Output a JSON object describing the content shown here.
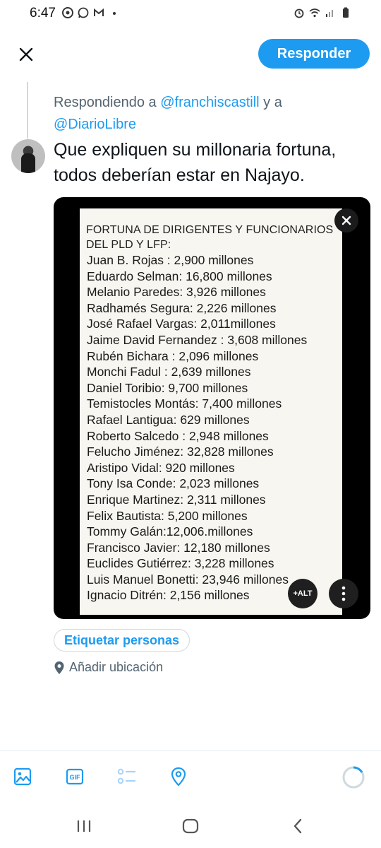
{
  "status_bar": {
    "time": "6:47",
    "left_icons": [
      "chrome-icon",
      "whatsapp-icon",
      "gmail-icon",
      "dot-icon"
    ],
    "right_icons": [
      "alarm-icon",
      "wifi-icon",
      "signal-icon",
      "battery-icon"
    ]
  },
  "header": {
    "reply_button_label": "Responder"
  },
  "reply_context": {
    "prefix": "Respondiendo a ",
    "handle_1": "@franchiscastill",
    "connector": " y a ",
    "handle_2": "@DiarioLibre"
  },
  "tweet": {
    "text": "Que expliquen su millonaria fortuna, todos deberían estar en Najayo."
  },
  "media": {
    "title": "FORTUNA DE DIRIGENTES Y FUNCIONARIOS\nDEL PLD Y LFP:",
    "lines": [
      "Juan B. Rojas : 2,900 millones",
      "Eduardo Selman: 16,800 millones",
      "Melanio Paredes: 3,926 millones",
      "Radhamés Segura: 2,226 millones",
      "José Rafael Vargas: 2,011millones",
      "Jaime David Fernandez : 3,608 millones",
      "Rubén Bichara : 2,096 millones",
      "Monchi Fadul : 2,639 millones",
      "Daniel Toribio: 9,700 millones",
      "Temistocles Montás: 7,400 millones",
      "Rafael Lantigua: 629 millones",
      "Roberto Salcedo : 2,948 millones",
      "Felucho Jiménez: 32,828 millones",
      "Aristipo Vidal: 920 millones",
      "Tony Isa Conde: 2,023 millones",
      "Enrique Martinez: 2,311 millones",
      "Felix Bautista: 5,200 millones",
      "Tommy Galán:12,006.millones",
      "Francisco Javier: 12,180 millones",
      "Euclides Gutiérrez: 3,228 millones",
      "Luis Manuel Bonetti: 23,946 millones",
      "Ignacio Ditrén: 2,156 millones"
    ],
    "alt_label": "+ALT"
  },
  "tag_people_label": "Etiquetar personas",
  "add_location_label": "Añadir ubicación",
  "toolbar": {
    "icons": [
      "image-icon",
      "gif-icon",
      "poll-icon",
      "location-icon"
    ]
  },
  "colors": {
    "accent": "#1d9bf0",
    "text_primary": "#0f1419",
    "text_secondary": "#536471"
  }
}
